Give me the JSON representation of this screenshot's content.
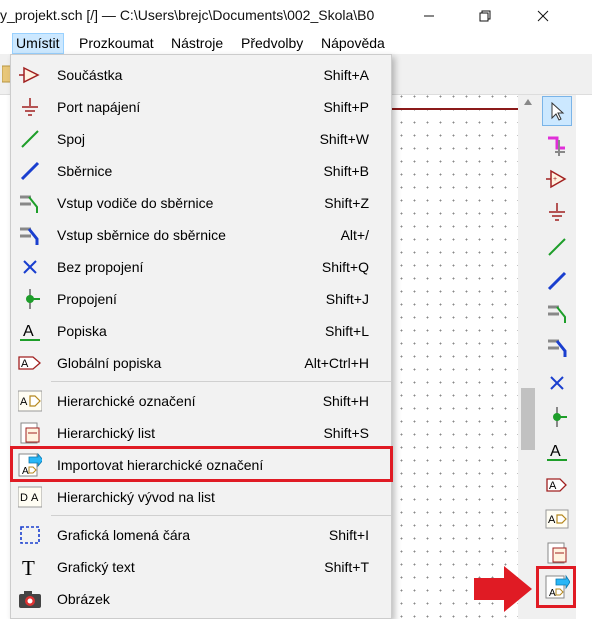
{
  "window": {
    "title": "y_projekt.sch [/] — C:\\Users\\brejc\\Documents\\002_Skola\\B0",
    "minimize_glyph": "—",
    "maximize_glyph": "❐",
    "close_glyph": "✕"
  },
  "menubar": [
    {
      "label": "Umístit",
      "active": true
    },
    {
      "label": "Prozkoumat"
    },
    {
      "label": "Nástroje"
    },
    {
      "label": "Předvolby"
    },
    {
      "label": "Nápověda"
    }
  ],
  "menu_items": [
    {
      "label": "Součástka",
      "shortcut": "Shift+A",
      "icon": "component-icon"
    },
    {
      "label": "Port napájení",
      "shortcut": "Shift+P",
      "icon": "power-port-icon"
    },
    {
      "label": "Spoj",
      "shortcut": "Shift+W",
      "icon": "wire-icon"
    },
    {
      "label": "Sběrnice",
      "shortcut": "Shift+B",
      "icon": "bus-icon"
    },
    {
      "label": "Vstup vodiče do sběrnice",
      "shortcut": "Shift+Z",
      "icon": "wire-to-bus-entry-icon"
    },
    {
      "label": "Vstup sběrnice do sběrnice",
      "shortcut": "Alt+/",
      "icon": "bus-to-bus-entry-icon"
    },
    {
      "label": "Bez propojení",
      "shortcut": "Shift+Q",
      "icon": "no-connect-icon"
    },
    {
      "label": "Propojení",
      "shortcut": "Shift+J",
      "icon": "junction-icon"
    },
    {
      "label": "Popiska",
      "shortcut": "Shift+L",
      "icon": "label-icon"
    },
    {
      "label": "Globální popiska",
      "shortcut": "Alt+Ctrl+H",
      "icon": "global-label-icon"
    },
    {
      "label": "Hierarchické označení",
      "shortcut": "Shift+H",
      "icon": "hierarchical-label-icon"
    },
    {
      "label": "Hierarchický list",
      "shortcut": "Shift+S",
      "icon": "hierarchical-sheet-icon"
    },
    {
      "label": "Importovat hierarchické označení",
      "shortcut": "",
      "icon": "import-hierarchical-label-icon"
    },
    {
      "label": "Hierarchický vývod na list",
      "shortcut": "",
      "icon": "sheet-pin-icon"
    },
    {
      "label": "Grafická lomená čára",
      "shortcut": "Shift+I",
      "icon": "graphic-polyline-icon"
    },
    {
      "label": "Grafický text",
      "shortcut": "Shift+T",
      "icon": "graphic-text-icon"
    },
    {
      "label": "Obrázek",
      "shortcut": "",
      "icon": "image-icon"
    }
  ],
  "right_toolbar": [
    "select-arrow-icon",
    "hierarchy-navigator-icon",
    "component-icon",
    "power-port-icon",
    "wire-icon",
    "bus-icon",
    "wire-to-bus-entry-icon",
    "bus-to-bus-entry-icon",
    "no-connect-icon",
    "junction-icon",
    "label-icon",
    "global-label-icon",
    "hierarchical-label-icon",
    "hierarchical-sheet-icon",
    "import-hierarchical-label-icon"
  ],
  "colors": {
    "highlight_red": "#e01b24",
    "wire_green": "#1e9e2a",
    "bus_blue": "#1a3fcf",
    "schematic_dark_red": "#8b1a1a",
    "menu_active_bg": "#cce8ff"
  }
}
